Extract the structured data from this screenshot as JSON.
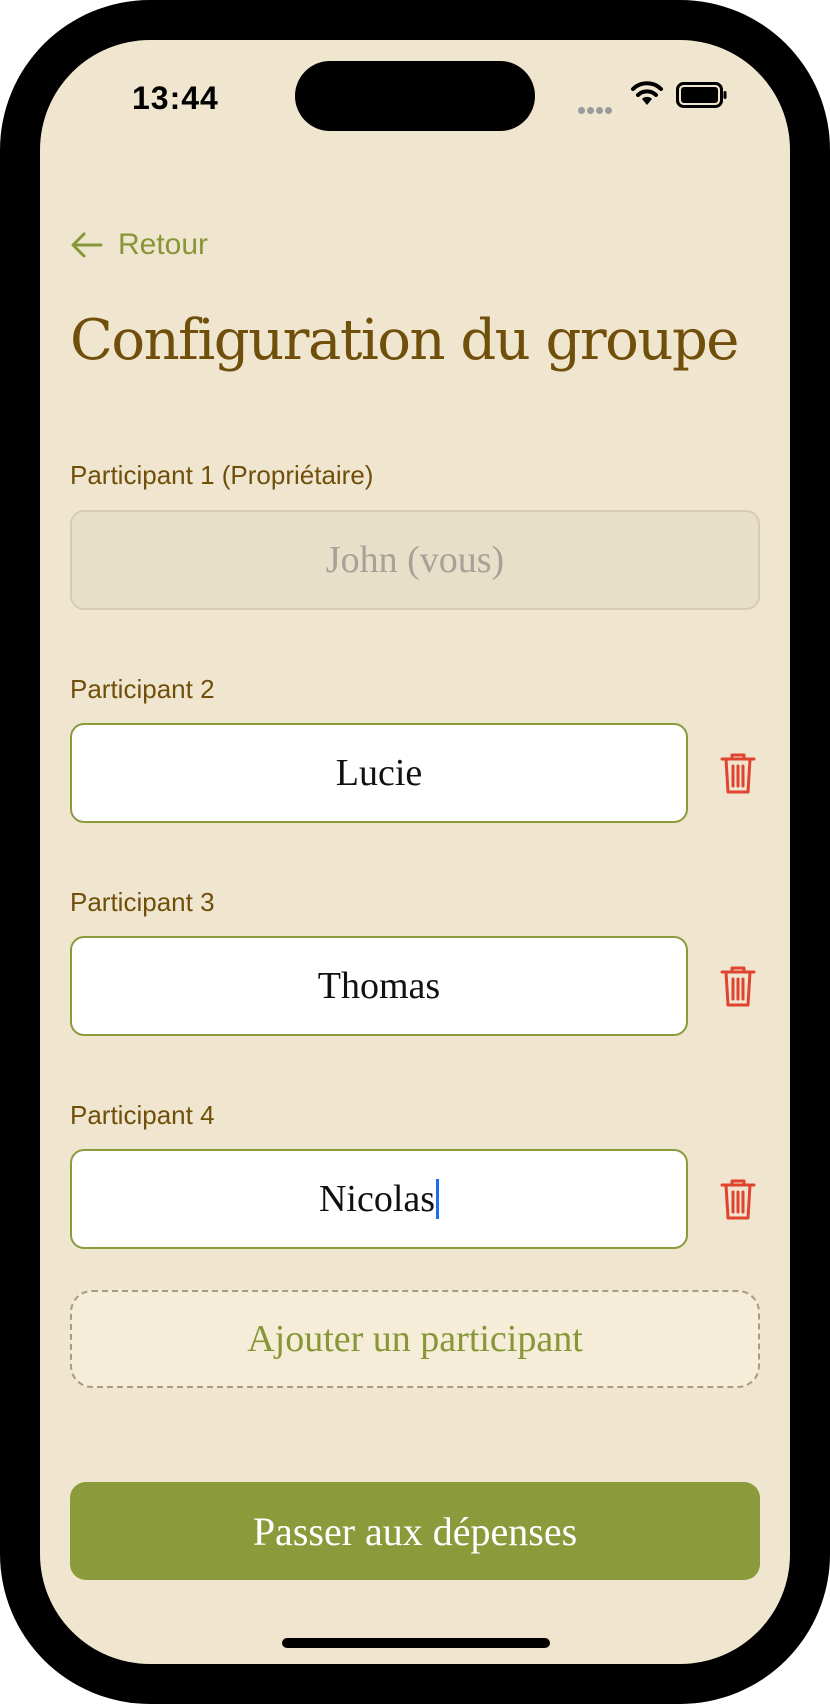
{
  "status_bar": {
    "time": "13:44"
  },
  "nav": {
    "back_label": "Retour",
    "icon": "arrow-left-icon"
  },
  "page": {
    "title": "Configuration du groupe"
  },
  "participants": [
    {
      "label": "Participant 1 (Propriétaire)",
      "value": "John (vous)",
      "editable": false
    },
    {
      "label": "Participant 2",
      "value": "Lucie",
      "editable": true
    },
    {
      "label": "Participant 3",
      "value": "Thomas",
      "editable": true
    },
    {
      "label": "Participant 4",
      "value": "Nicolas",
      "editable": true,
      "focused": true
    }
  ],
  "actions": {
    "add_participant": "Ajouter un participant",
    "next": "Passer aux dépenses"
  },
  "colors": {
    "background": "#f0e6d0",
    "accent": "#8b9a3b",
    "title": "#704f0b",
    "delete": "#e0432f"
  }
}
